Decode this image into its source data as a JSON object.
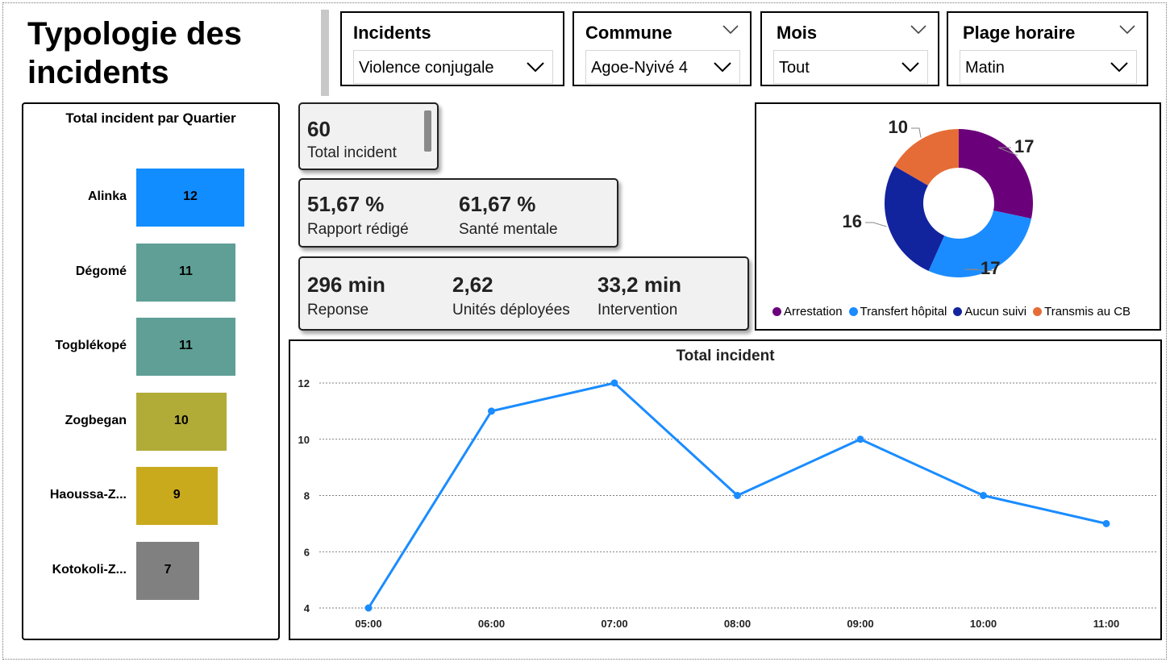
{
  "page": {
    "title": "Typologie des incidents"
  },
  "filters": [
    {
      "title": "Incidents",
      "value": "Violence conjugale",
      "show_header_chevron": false
    },
    {
      "title": "Commune",
      "value": "Agoe-Nyivé 4",
      "show_header_chevron": true
    },
    {
      "title": "Mois",
      "value": "Tout",
      "show_header_chevron": true
    },
    {
      "title": "Plage horaire",
      "value": "Matin",
      "show_header_chevron": true
    }
  ],
  "kpis": {
    "total": {
      "value": "60",
      "label": "Total incident"
    },
    "rapport": {
      "value": "51,67 %",
      "label": "Rapport rédigé"
    },
    "sante": {
      "value": "61,67 %",
      "label": "Santé mentale"
    },
    "reponse": {
      "value": "296 min",
      "label": "Reponse"
    },
    "unites": {
      "value": "2,62",
      "label": "Unités déployées"
    },
    "intervention": {
      "value": "33,2 min",
      "label": "Intervention"
    }
  },
  "chart_data": [
    {
      "type": "bar",
      "title": "Total incident par Quartier",
      "categories": [
        "Alinka",
        "Dégomé",
        "Togblékopé",
        "Zogbegan",
        "Haoussa-Z...",
        "Kotokoli-Z..."
      ],
      "values": [
        12,
        11,
        11,
        10,
        9,
        7
      ],
      "colors": [
        "#118dff",
        "#5f9f96",
        "#5f9f96",
        "#b1ab37",
        "#c9aa1c",
        "#808080"
      ],
      "orientation": "horizontal",
      "data_labels": true
    },
    {
      "type": "pie",
      "title": "",
      "donut": true,
      "categories": [
        "Arrestation",
        "Transfert hôpital",
        "Aucun suivi",
        "Transmis au CB"
      ],
      "values": [
        17,
        17,
        16,
        10
      ],
      "colors": [
        "#6b007b",
        "#1a8cff",
        "#12239e",
        "#e66c37"
      ],
      "legend": "bottom",
      "data_labels": true
    },
    {
      "type": "line",
      "title": "Total incident",
      "x": [
        "05:00",
        "06:00",
        "07:00",
        "08:00",
        "09:00",
        "10:00",
        "11:00"
      ],
      "series": [
        {
          "values": [
            4,
            11,
            12,
            8,
            10,
            8,
            7
          ],
          "color": "#1a8cff"
        }
      ],
      "yticks": [
        4,
        6,
        8,
        10,
        12
      ],
      "ylim": [
        4,
        12
      ],
      "grid": "horizontal dotted",
      "xlabel": "",
      "ylabel": ""
    }
  ]
}
